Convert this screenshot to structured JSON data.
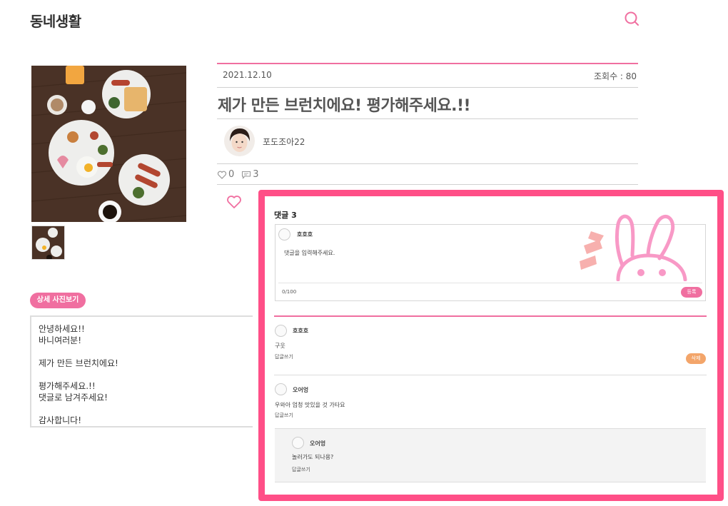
{
  "header": {
    "brand": "동네생활",
    "search_icon": "search-icon"
  },
  "gallery": {
    "detail_button": "상세 사진보기"
  },
  "description": {
    "lines": [
      "안녕하세요!!",
      "바니여러분!",
      "",
      "제가 만든 브런치에요!",
      "",
      "평가해주세요.!!",
      "댓글로 남겨주세요!",
      "",
      "감사합니다!"
    ]
  },
  "post": {
    "date": "2021.12.10",
    "views": "조회수 : 80",
    "title": "제가 만든 브런치에요! 평가해주세요.!!",
    "author": "포도조아22",
    "likes": "0",
    "comment_count": "3"
  },
  "comments": {
    "title": "댓글 3",
    "form": {
      "user": "호호호",
      "placeholder": "댓글을 입력해주세요.",
      "counter": "0/100",
      "submit": "등록"
    },
    "items": [
      {
        "user": "호호호",
        "text": "구웃",
        "reply": "답글쓰기",
        "delete": "삭제"
      },
      {
        "user": "오어엉",
        "text": "우와아 엄청 맛있을 것 가타요",
        "reply": "답글쓰기"
      }
    ],
    "nested_reply": {
      "user": "오어엉",
      "text": "놀러가도 되나용?",
      "reply": "답글쓰기"
    }
  },
  "colors": {
    "accent": "#f06fa0",
    "panel_border": "#ff4f87",
    "delete": "#f3a56a"
  }
}
